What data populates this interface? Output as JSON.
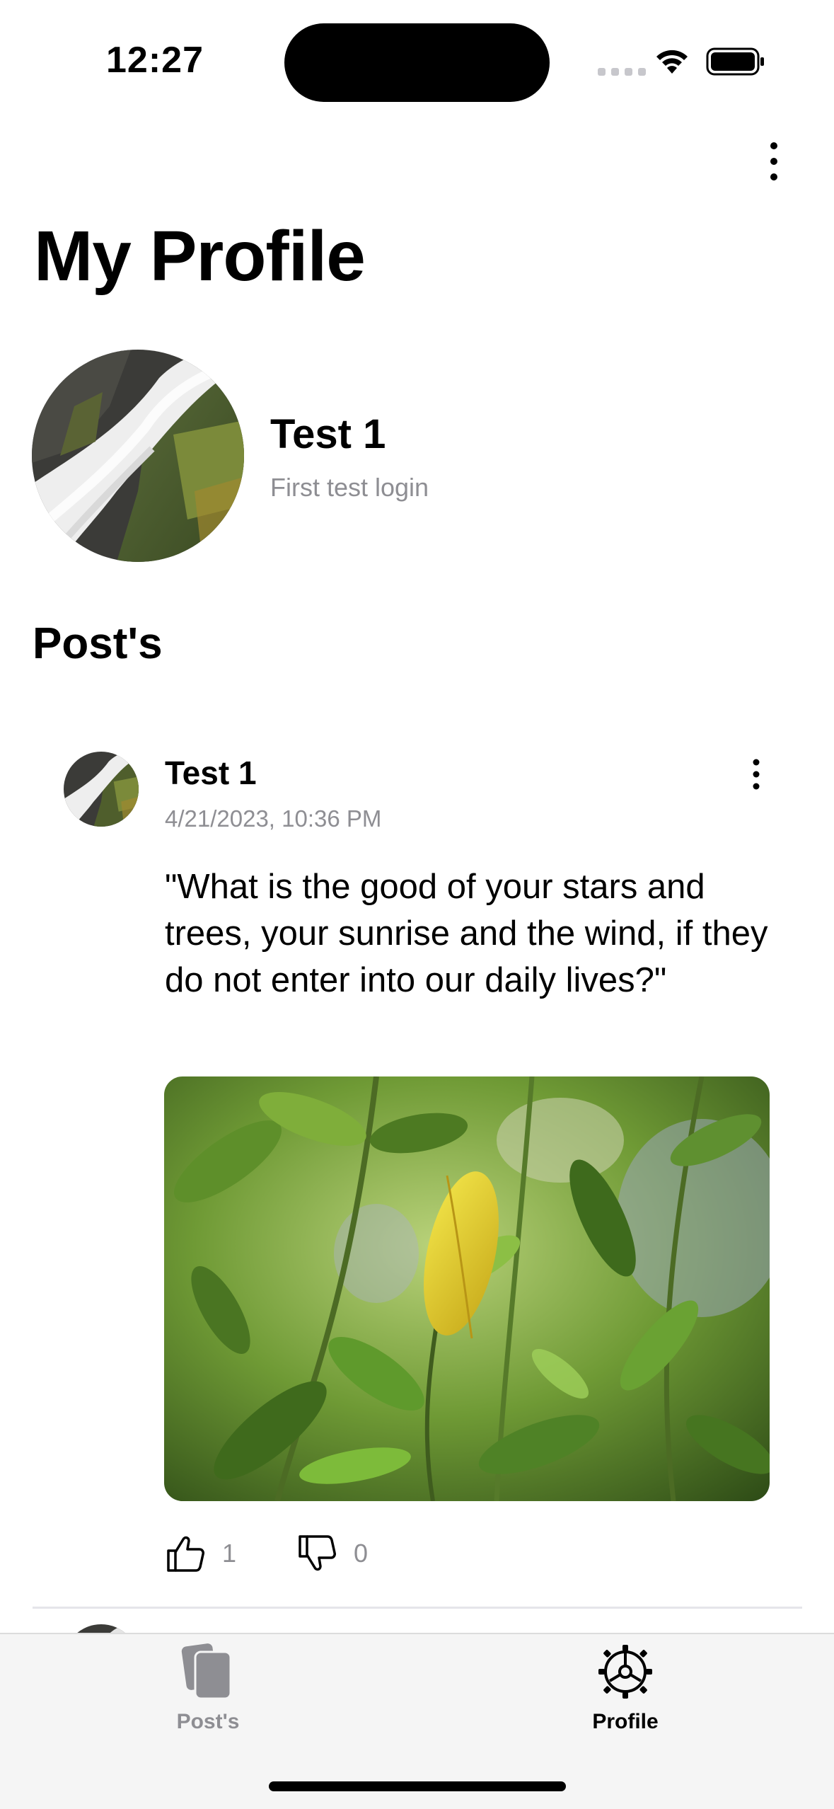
{
  "status_bar": {
    "time": "12:27"
  },
  "header": {
    "title": "My Profile",
    "menu_icon": "ellipsis-vertical-icon"
  },
  "profile": {
    "name": "Test 1",
    "bio": "First test login"
  },
  "posts_section": {
    "title": "Post's"
  },
  "posts": [
    {
      "author": "Test 1",
      "date": "4/21/2023, 10:36 PM",
      "text": "\"What is the good of your stars and trees, your sunrise and the wind, if they do not enter into our daily lives?\"",
      "likes": "1",
      "dislikes": "0"
    }
  ],
  "tab_bar": {
    "tabs": [
      {
        "label": "Post's",
        "icon": "documents-icon",
        "active": false
      },
      {
        "label": "Profile",
        "icon": "gear-icon",
        "active": true
      }
    ]
  },
  "colors": {
    "primary_text": "#000000",
    "secondary_text": "#8e8e93",
    "tab_bar_bg": "#f5f5f5"
  }
}
